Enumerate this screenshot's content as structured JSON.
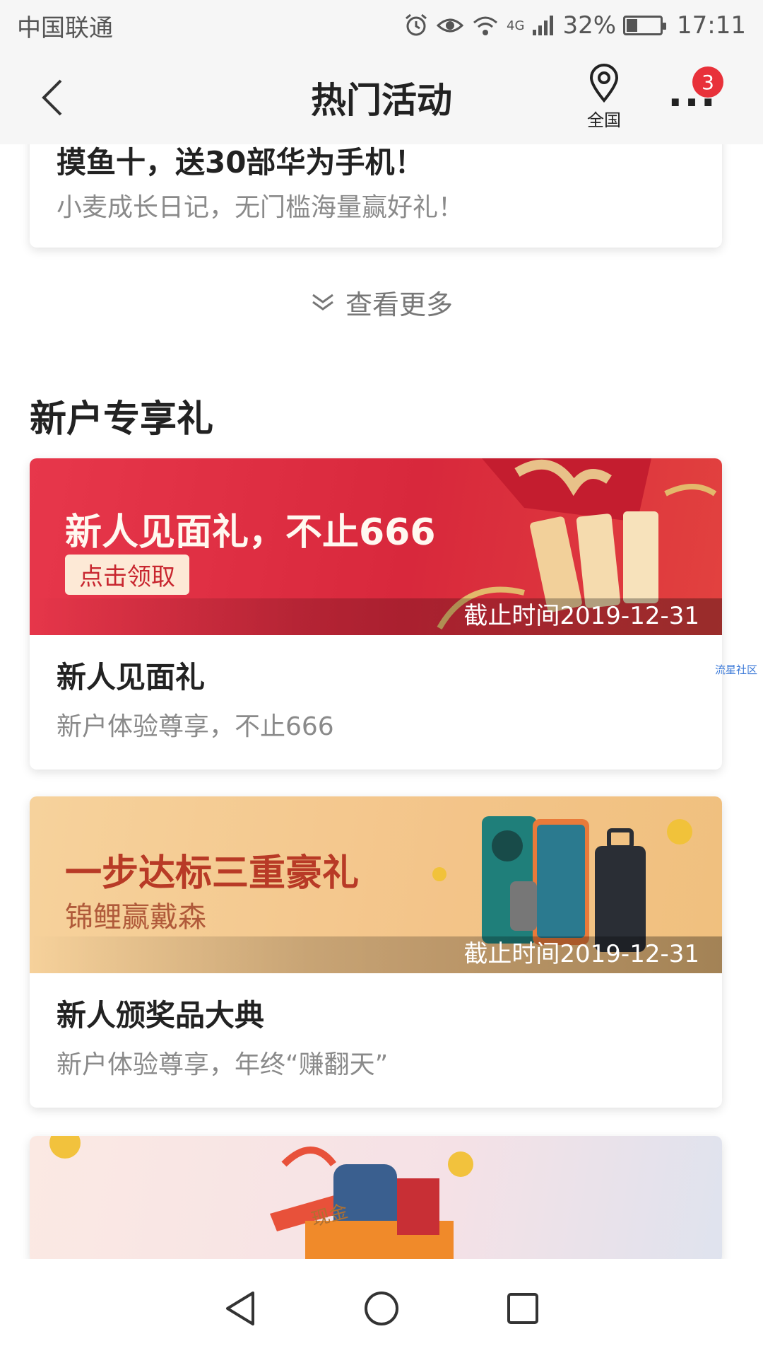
{
  "status_bar": {
    "carrier": "中国联通",
    "network": "4G",
    "battery": "32%",
    "battery_level": 0.32,
    "time": "17:11",
    "icons": [
      "alarm-icon",
      "eye-icon",
      "wifi-icon",
      "signal-icon",
      "battery-icon"
    ]
  },
  "header": {
    "title": "热门活动",
    "location_label": "全国",
    "notification_count": "3"
  },
  "previous_card": {
    "title": "摸鱼十，送30部华为手机！",
    "subtitle": "小麦成长日记，无门槛海量赢好礼！"
  },
  "see_more": {
    "label": "查看更多"
  },
  "section": {
    "title": "新户专享礼",
    "cards": [
      {
        "banner_headline": "新人见面礼，不止666",
        "banner_button": "点击领取",
        "deadline": "截止时间2019-12-31",
        "title": "新人见面礼",
        "subtitle": "新户体验尊享，不止666"
      },
      {
        "banner_headline": "一步达标三重豪礼",
        "banner_sub": "锦鲤赢戴森",
        "deadline": "截止时间2019-12-31",
        "title": "新人颁奖品大典",
        "subtitle": "新户体验尊享，年终“赚翻天”"
      },
      {
        "banner_labels": [
          "现金"
        ]
      }
    ]
  },
  "watermark": "流星社区",
  "colors": {
    "accent_red": "#e8313a",
    "banner_red": "#d8283c",
    "banner_gold": "#f3c489"
  }
}
